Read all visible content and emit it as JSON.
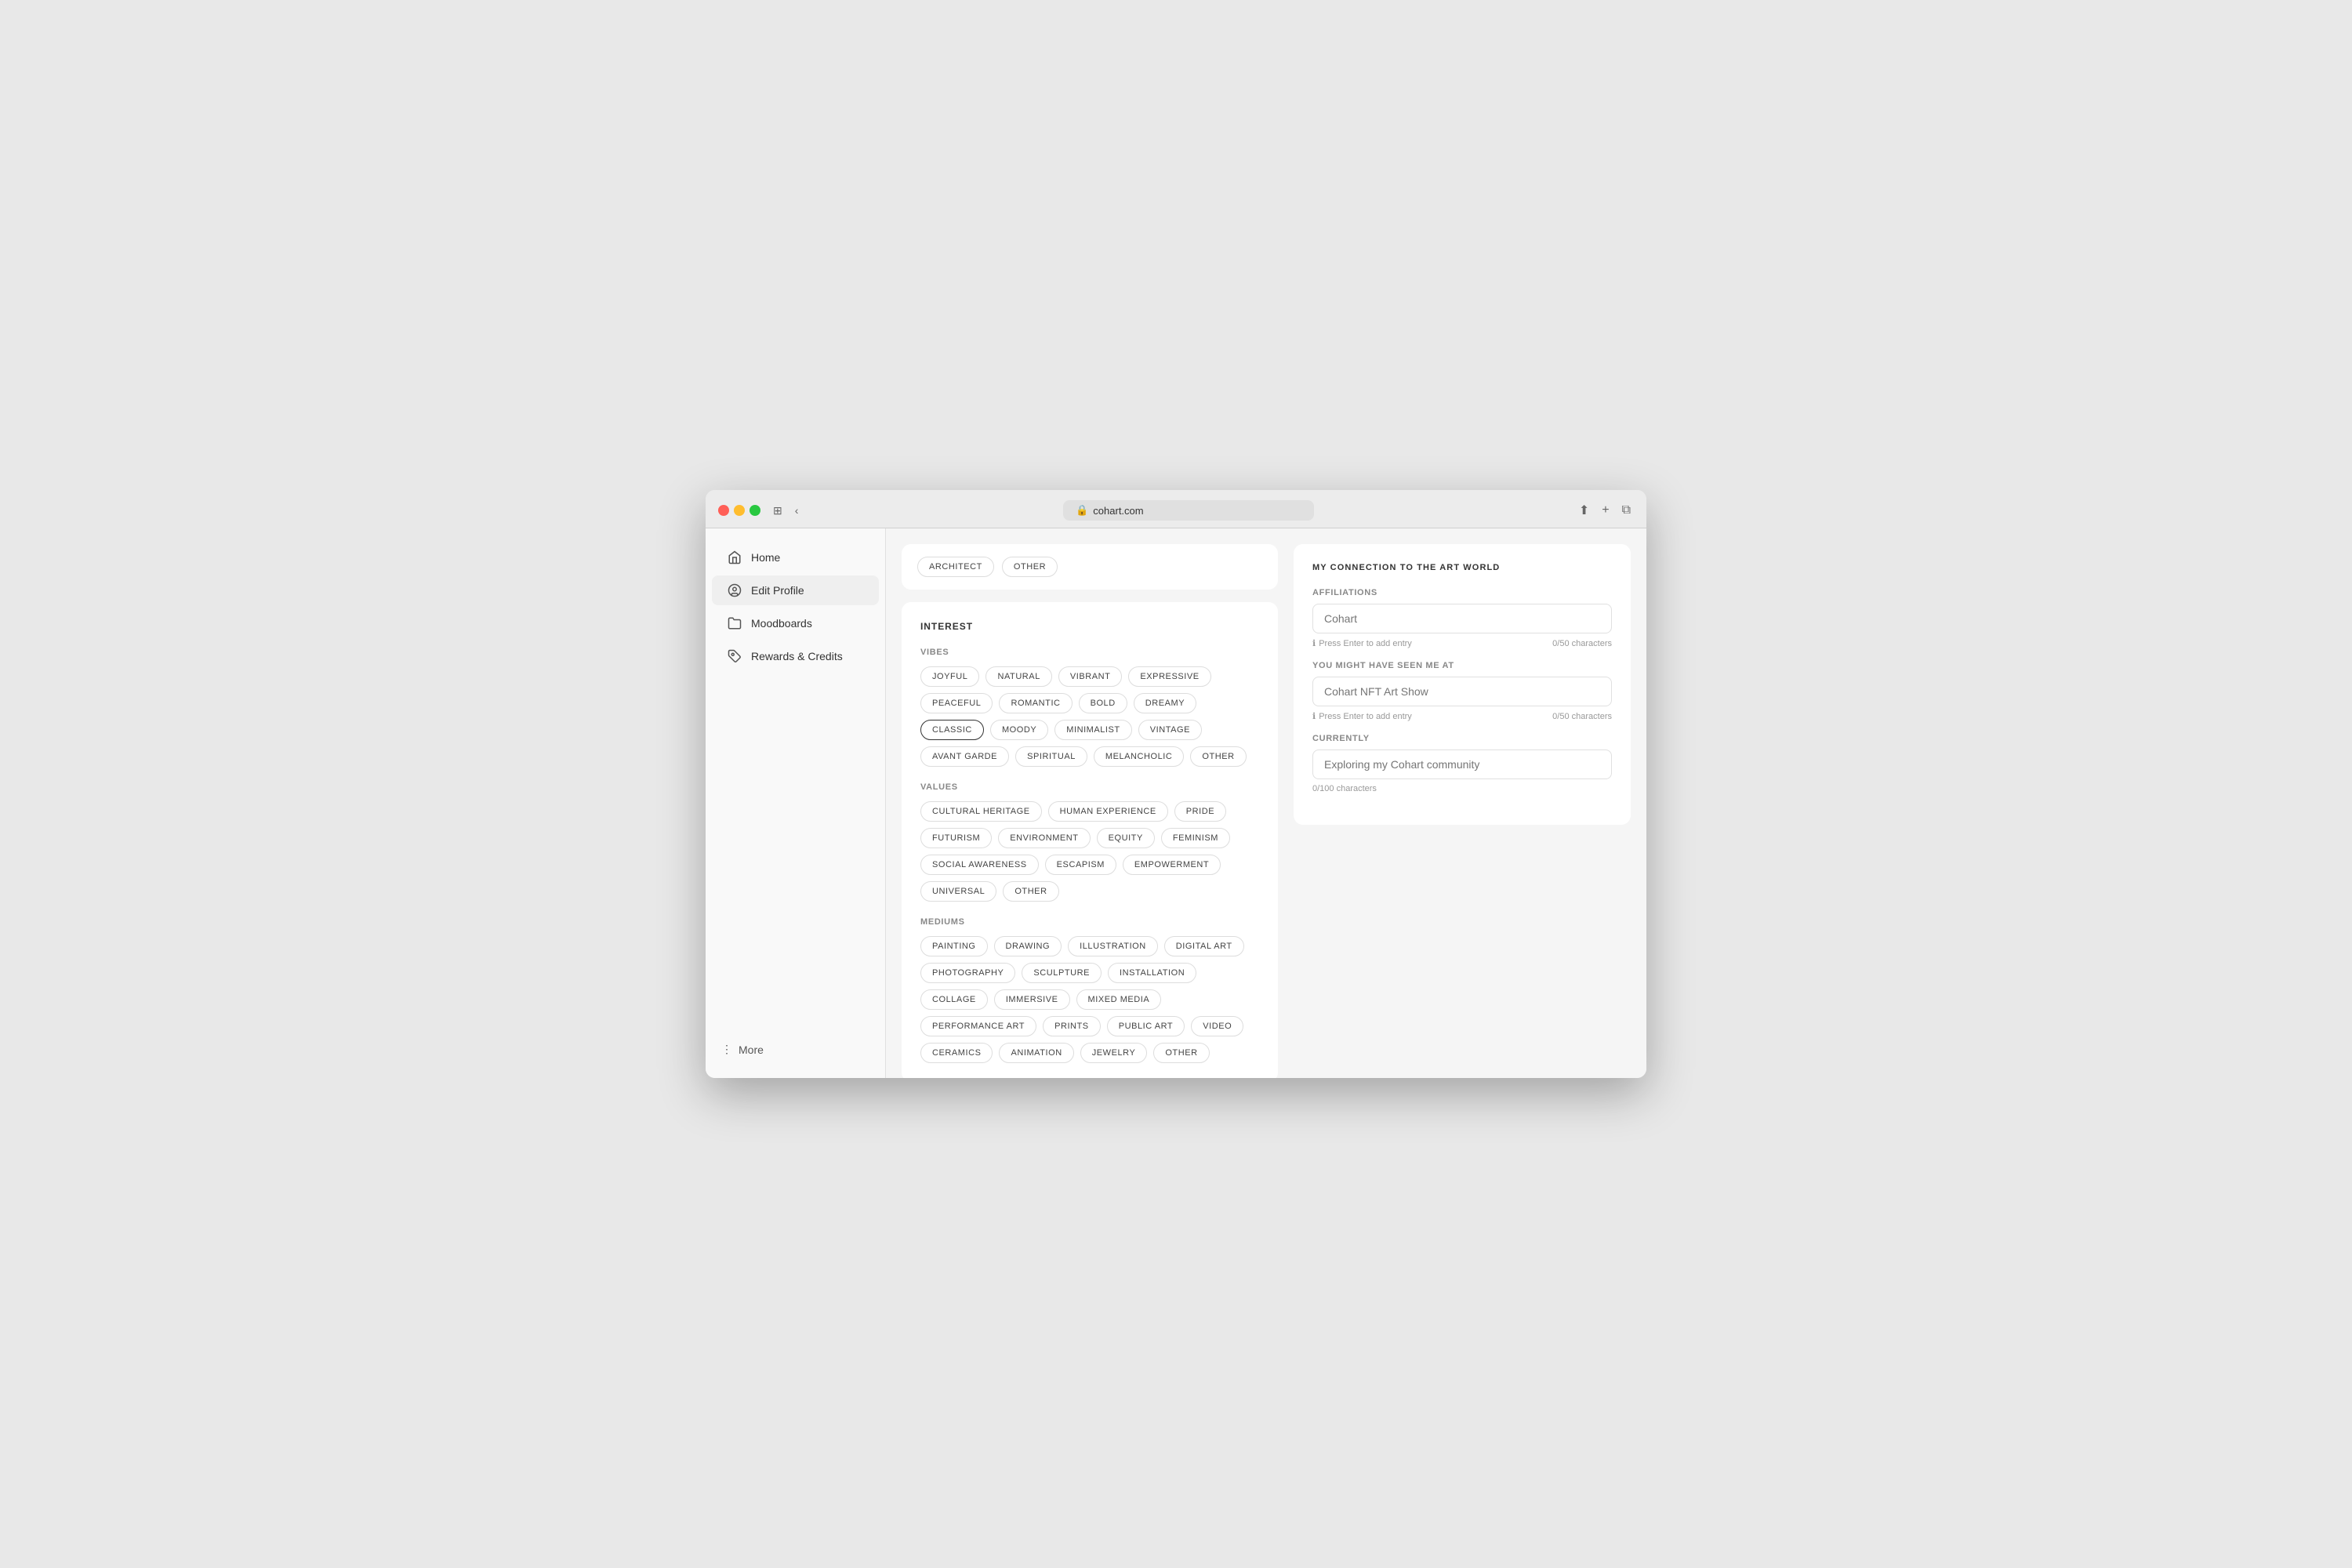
{
  "browser": {
    "url": "cohart.com",
    "traffic_lights": [
      "red",
      "yellow",
      "green"
    ]
  },
  "sidebar": {
    "items": [
      {
        "id": "home",
        "label": "Home",
        "icon": "home"
      },
      {
        "id": "edit-profile",
        "label": "Edit Profile",
        "icon": "user-circle",
        "active": true
      },
      {
        "id": "moodboards",
        "label": "Moodboards",
        "icon": "folder"
      },
      {
        "id": "rewards",
        "label": "Rewards & Credits",
        "icon": "tag"
      }
    ],
    "more_label": "More"
  },
  "top_partial": {
    "tags": [
      "ARCHITECT",
      "OTHER"
    ]
  },
  "interest": {
    "section_title": "INTEREST",
    "vibes": {
      "label": "VIBES",
      "tags": [
        "JOYFUL",
        "NATURAL",
        "VIBRANT",
        "EXPRESSIVE",
        "PEACEFUL",
        "ROMANTIC",
        "BOLD",
        "DREAMY",
        "CLASSIC",
        "MOODY",
        "MINIMALIST",
        "VINTAGE",
        "AVANT GARDE",
        "SPIRITUAL",
        "MELANCHOLIC",
        "OTHER"
      ]
    },
    "values": {
      "label": "VALUES",
      "tags": [
        "CULTURAL HERITAGE",
        "HUMAN EXPERIENCE",
        "PRIDE",
        "FUTURISM",
        "ENVIRONMENT",
        "EQUITY",
        "FEMINISM",
        "SOCIAL AWARENESS",
        "ESCAPISM",
        "EMPOWERMENT",
        "UNIVERSAL",
        "OTHER"
      ]
    },
    "mediums": {
      "label": "MEDIUMS",
      "tags": [
        "PAINTING",
        "DRAWING",
        "ILLUSTRATION",
        "DIGITAL ART",
        "PHOTOGRAPHY",
        "SCULPTURE",
        "INSTALLATION",
        "COLLAGE",
        "IMMERSIVE",
        "MIXED MEDIA",
        "PERFORMANCE ART",
        "PRINTS",
        "PUBLIC ART",
        "VIDEO",
        "CERAMICS",
        "ANIMATION",
        "JEWELRY",
        "OTHER"
      ]
    }
  },
  "connection": {
    "title": "MY CONNECTION TO THE ART WORLD",
    "affiliations": {
      "label": "AFFILIATIONS",
      "placeholder": "Cohart",
      "hint": "Press Enter to add entry",
      "char_count": "0/50 characters"
    },
    "seen_at": {
      "label": "YOU MIGHT HAVE SEEN ME AT",
      "placeholder": "Cohart NFT Art Show",
      "hint": "Press Enter to add entry",
      "char_count": "0/50 characters"
    },
    "currently": {
      "label": "CURRENTLY",
      "placeholder": "Exploring my Cohart community",
      "char_count": "0/100 characters"
    }
  }
}
